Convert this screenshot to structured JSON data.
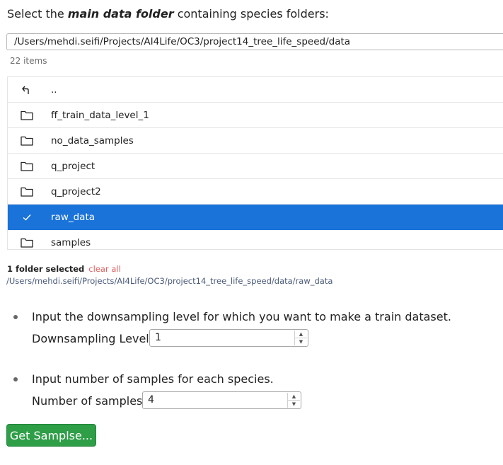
{
  "heading": {
    "prefix": "Select the ",
    "emphasis": "main data folder",
    "suffix": " containing species folders:"
  },
  "path_input": {
    "value": "/Users/mehdi.seifi/Projects/AI4Life/OC3/project14_tree_life_speed/data"
  },
  "items_count": "22 items",
  "files": [
    {
      "name": "..",
      "icon": "parent-dir-arrow-icon",
      "selected": false
    },
    {
      "name": "ff_train_data_level_1",
      "icon": "folder-icon",
      "selected": false
    },
    {
      "name": "no_data_samples",
      "icon": "folder-icon",
      "selected": false
    },
    {
      "name": "q_project",
      "icon": "folder-icon",
      "selected": false
    },
    {
      "name": "q_project2",
      "icon": "folder-icon",
      "selected": false
    },
    {
      "name": "raw_data",
      "icon": "checkmark-icon",
      "selected": true
    },
    {
      "name": "samples",
      "icon": "folder-icon",
      "selected": false
    }
  ],
  "selection": {
    "summary": "1 folder selected",
    "clear_label": "clear all",
    "path": "/Users/mehdi.seifi/Projects/AI4Life/OC3/project14_tree_life_speed/data/raw_data"
  },
  "downsampling": {
    "prompt": "Input the downsampling level for which you want to make a train dataset.",
    "label": "Downsampling Level:",
    "value": "1"
  },
  "samples": {
    "prompt": "Input number of samples for each species.",
    "label": "Number of samples:",
    "value": "4"
  },
  "button": {
    "label": "Get Samplse..."
  },
  "colors": {
    "selected_row": "#1a73d9",
    "button": "#2e9e47",
    "clear_link": "#e06060"
  }
}
